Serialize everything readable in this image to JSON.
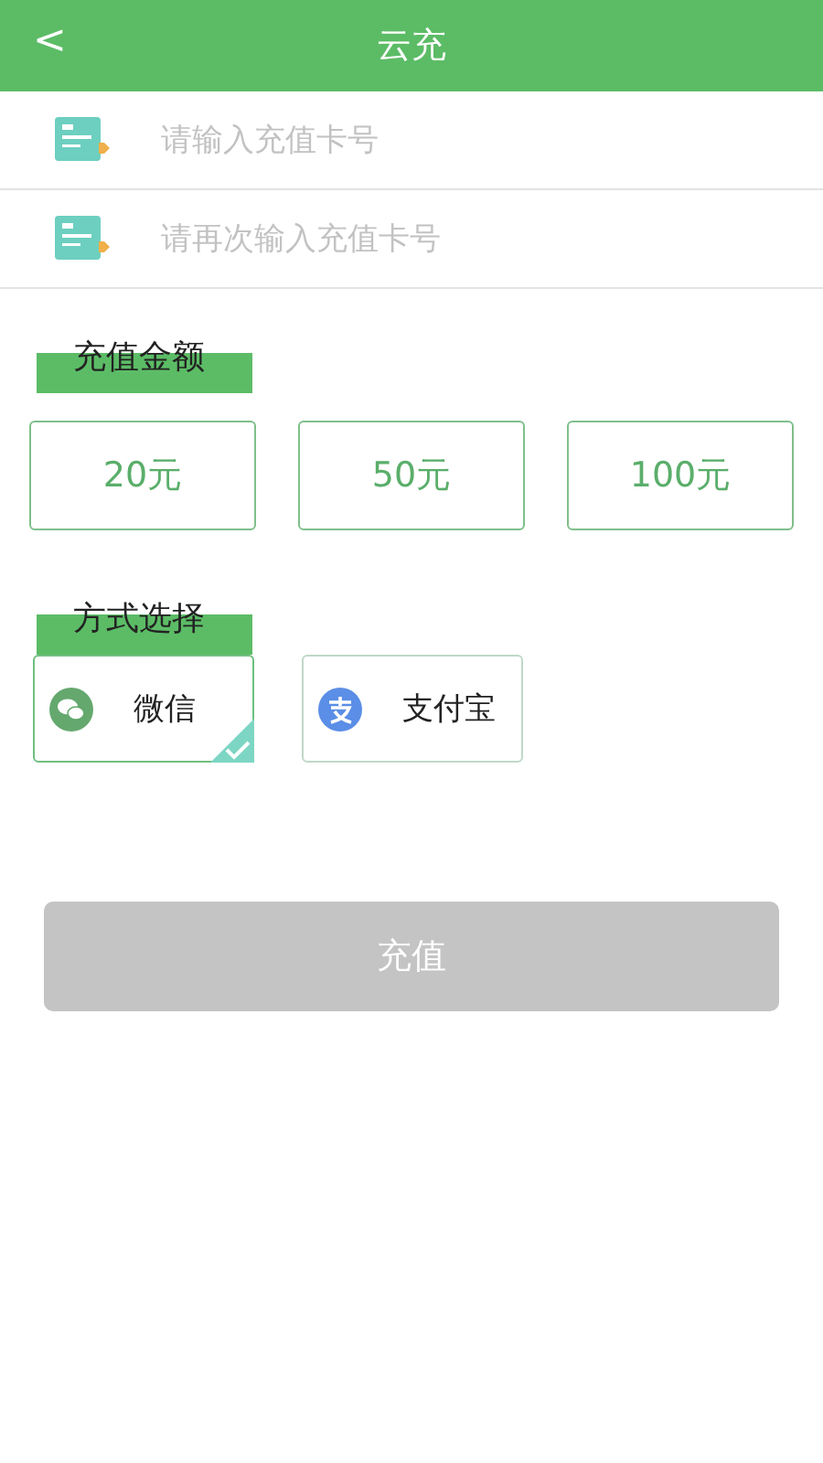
{
  "header": {
    "back": "<",
    "title": "云充"
  },
  "fields": [
    {
      "placeholder": "请输入充值卡号"
    },
    {
      "placeholder": "请再次输入充值卡号"
    }
  ],
  "amount_section": {
    "heading": "充值金额",
    "options": [
      {
        "label": "20元",
        "selected": false
      },
      {
        "label": "50元",
        "selected": false
      },
      {
        "label": "100元",
        "selected": false
      }
    ]
  },
  "payment_section": {
    "heading": "方式选择",
    "methods": [
      {
        "kind": "wechat",
        "label": "微信",
        "selected": true
      },
      {
        "kind": "alipay",
        "label": "支付宝",
        "selected": false
      }
    ]
  },
  "submit": {
    "label": "充值",
    "disabled": true
  }
}
